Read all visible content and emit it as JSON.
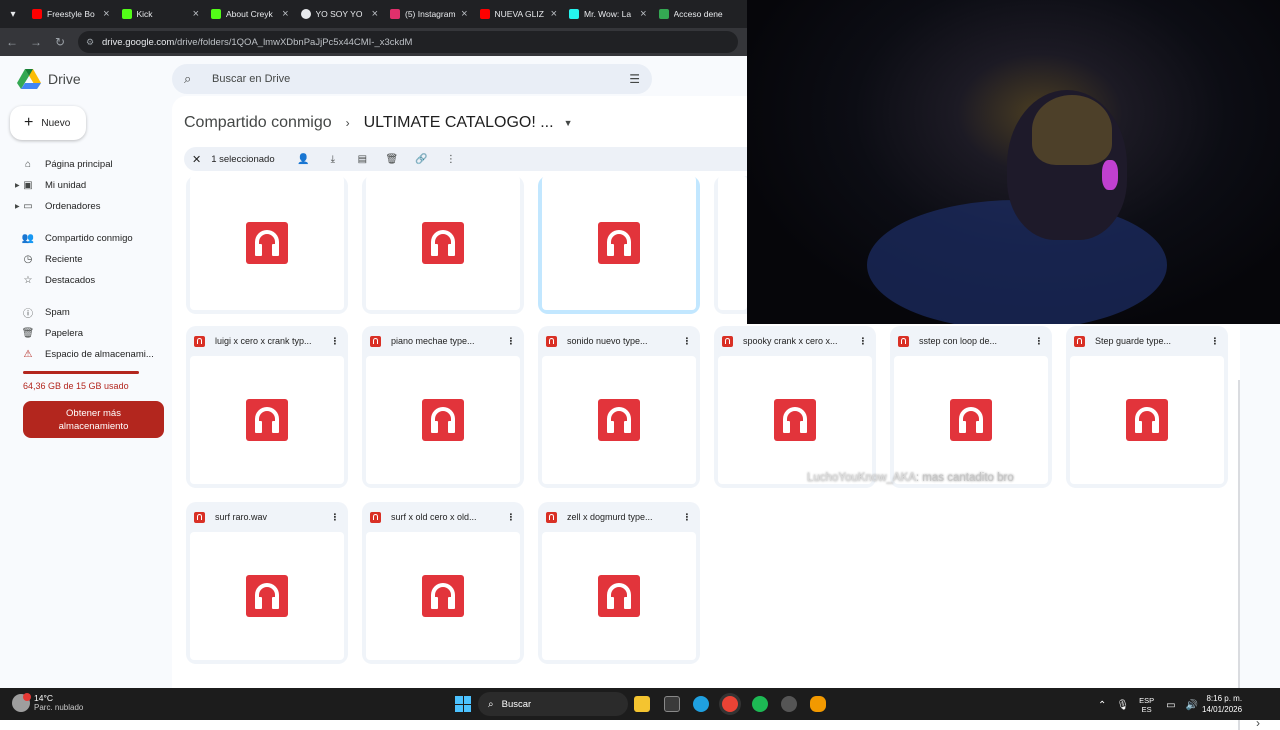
{
  "browser": {
    "tabs": [
      {
        "label": "Freestyle Bo",
        "color": "#ff0000"
      },
      {
        "label": "Kick",
        "color": "#53fc18"
      },
      {
        "label": "About Creyk",
        "color": "#53fc18"
      },
      {
        "label": "YO SOY YO",
        "color": "#e8eaed"
      },
      {
        "label": "(5) Instagram",
        "color": "#e1306c"
      },
      {
        "label": "NUEVA GLIZ",
        "color": "#ff0000"
      },
      {
        "label": "Mr. Wow: La",
        "color": "#25f4ee"
      },
      {
        "label": "Acceso dene",
        "color": "#34a853"
      }
    ],
    "tab_close": "×",
    "url_domain": "drive.google.com",
    "url_path": "/drive/folders/1QOA_lmwXDbnPaJjPc5x44CMI-_x3ckdM"
  },
  "drive": {
    "app_name": "Drive",
    "search_placeholder": "Buscar en Drive",
    "new_label": "Nuevo",
    "nav": [
      {
        "label": "Página principal",
        "icon": "home-icon"
      },
      {
        "label": "Mi unidad",
        "icon": "drive-icon"
      },
      {
        "label": "Ordenadores",
        "icon": "computer-icon"
      },
      {
        "label": "Compartido conmigo",
        "icon": "shared-icon"
      },
      {
        "label": "Reciente",
        "icon": "clock-icon"
      },
      {
        "label": "Destacados",
        "icon": "star-icon"
      },
      {
        "label": "Spam",
        "icon": "spam-icon"
      },
      {
        "label": "Papelera",
        "icon": "trash-icon"
      },
      {
        "label": "Espacio de almacenami...",
        "icon": "warning-icon"
      }
    ],
    "storage_text": "64,36 GB de 15 GB usado",
    "storage_fraction": 1.0,
    "storage_button": "Obtener más almacenamiento",
    "breadcrumb": {
      "parent": "Compartido conmigo",
      "current": "ULTIMATE CATALOGO! ..."
    },
    "selection": {
      "count_label": "1 seleccionado"
    },
    "files_row2": [
      "luigi x cero x crank typ...",
      "piano mechae type...",
      "sonido nuevo type...",
      "spooky crank x cero x...",
      "sstep con loop de...",
      "Step guarde type..."
    ],
    "files_row3": [
      "surf raro.wav",
      "surf x old cero x old...",
      "zell x dogmurd type..."
    ]
  },
  "stream_chat": {
    "user": "LuchoYouKnow_AKA",
    "message": ": mas cantadito bro"
  },
  "taskbar": {
    "weather_temp": "14°C",
    "weather_desc": "Parc. nublado",
    "search_label": "Buscar",
    "lang_top": "ESP",
    "lang_bottom": "ES",
    "time": "8:16 p. m.",
    "date": "14/01/2026"
  }
}
